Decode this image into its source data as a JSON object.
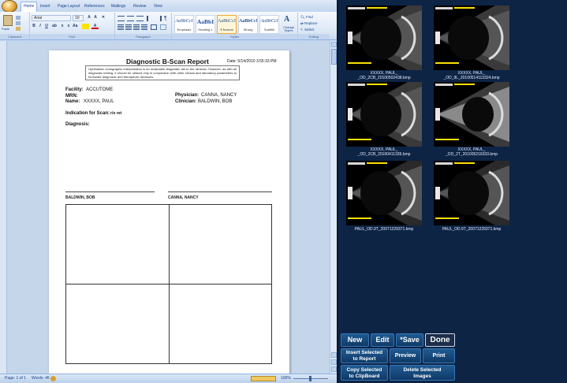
{
  "word": {
    "tabs": [
      "Home",
      "Insert",
      "Page Layout",
      "References",
      "Mailings",
      "Review",
      "View"
    ],
    "clipboard": {
      "paste_label": "Paste",
      "group_label": "Clipboard"
    },
    "font": {
      "family": "Arial",
      "size": "10",
      "group_label": "Font"
    },
    "paragraph": {
      "group_label": "Paragraph"
    },
    "styles": {
      "group_label": "Styles",
      "items": [
        {
          "sample": "AaBbCcI",
          "name": "Emphasis"
        },
        {
          "sample": "AaBbI",
          "name": "Heading 1"
        },
        {
          "sample": "AaBbCcI",
          "name": "¶ Normal"
        },
        {
          "sample": "AaBbCcI",
          "name": "Strong"
        },
        {
          "sample": "AaBbCcI",
          "name": "Subtitle"
        }
      ],
      "change_styles": "Change Styles"
    },
    "editing": {
      "find": "Find",
      "replace": "Replace",
      "select": "Select",
      "group_label": "Editing"
    },
    "status": {
      "page": "Page: 1 of 1",
      "words": "Words: 46"
    },
    "zoom": "100%"
  },
  "report": {
    "title": "Diagnostic B-Scan Report",
    "date": "Date: 5/14/2010  3:55:33  PM",
    "disclaimer": "Ophthalmic echographic interpretation is an invaluable diagnostic aid to the clinician. However, as with all diagnostic testing, it should be utilized only in conjunction with other clinical and laboratory parameters to formulate diagnostic and therapeutic decisions.",
    "facility_label": "Facility:",
    "facility": "ACCUTOME",
    "mrn_label": "MRN:",
    "name_label": "Name:",
    "name": "XXXXX, PAUL",
    "physician_label": "Physician:",
    "physician": "CANNA, NANCY",
    "clinician_label": "Clinician:",
    "clinician": "BALDWIN, BOB",
    "indication_label": "Indication for Scan:",
    "indication": "r/o ret",
    "diagnosis_label": "Diagnosis:",
    "signature_left": "BALDWIN, BOB",
    "signature_right": "CANNA, NANCY"
  },
  "images": [
    {
      "line1": "",
      "line2": ""
    },
    {
      "line1": "",
      "line2": ""
    },
    {
      "line1": "XXXXX, PAUL_",
      "line2": "_OD_2CB_20100502438.bmp"
    },
    {
      "line1": "XXXXX, PAUL_",
      "line2": "_OD_9L_20100514113324.bmp"
    },
    {
      "line1": "XXXXX, PAUL_",
      "line2": "_OD_2CB_20100411339.bmp"
    },
    {
      "line1": "XXXXX, PAUL_",
      "line2": "_OD_2T_201005216333.bmp"
    },
    {
      "line1": "PAUL_OD.9T_20071229371.bmp",
      "line2": ""
    },
    {
      "line1": "PAUL_OD.9T_20071229371.bmp",
      "line2": ""
    }
  ],
  "buttons": {
    "new": "New",
    "edit": "Edit",
    "save": "*Save",
    "done": "Done",
    "insert_line1": "Insert Selected",
    "insert_line2": "to Report",
    "preview": "Preview",
    "print": "Print",
    "copy_line1": "Copy Selected",
    "copy_line2": "to ClipBoard",
    "delete_line1": "Delete Selected",
    "delete_line2": "Images"
  }
}
